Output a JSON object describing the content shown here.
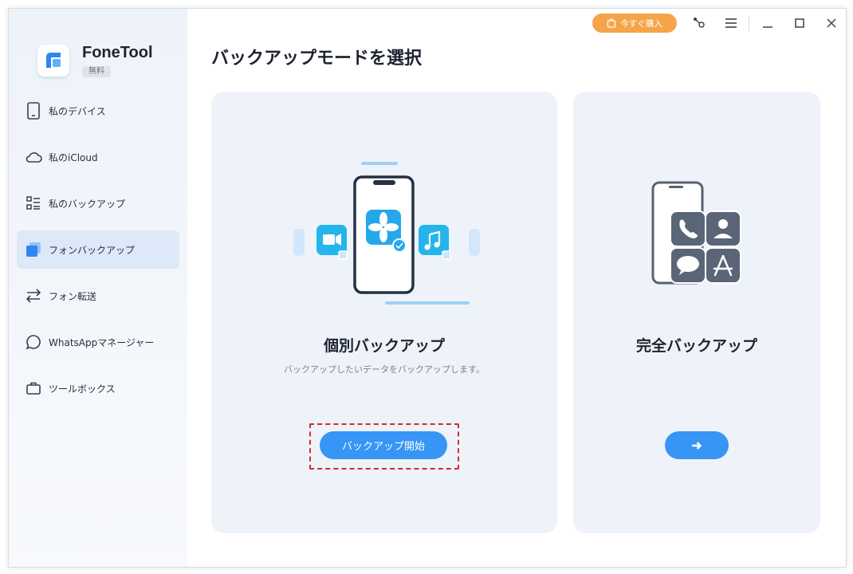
{
  "app": {
    "name": "FoneTool",
    "badge": "無料"
  },
  "titlebar": {
    "buy_label": "今すぐ購入"
  },
  "sidebar": {
    "items": [
      {
        "label": "私のデバイス",
        "icon": "phone-icon"
      },
      {
        "label": "私のiCloud",
        "icon": "cloud-icon"
      },
      {
        "label": "私のバックアップ",
        "icon": "backup-list-icon"
      },
      {
        "label": "フォンバックアップ",
        "icon": "phone-backup-icon",
        "active": true
      },
      {
        "label": "フォン転送",
        "icon": "transfer-icon"
      },
      {
        "label": "WhatsAppマネージャー",
        "icon": "chat-icon"
      },
      {
        "label": "ツールボックス",
        "icon": "toolbox-icon"
      }
    ]
  },
  "main": {
    "title": "バックアップモードを選択",
    "selective": {
      "title": "個別バックアップ",
      "description": "バックアップしたいデータをバックアップします。",
      "button_label": "バックアップ開始"
    },
    "full": {
      "title": "完全バックアップ",
      "button_label": "➜"
    }
  },
  "colors": {
    "accent": "#3795f5",
    "buy": "#f6a44a",
    "active_nav": "#dde9f8",
    "card_bg": "#eef3fa",
    "highlight": "#d52b2b"
  }
}
